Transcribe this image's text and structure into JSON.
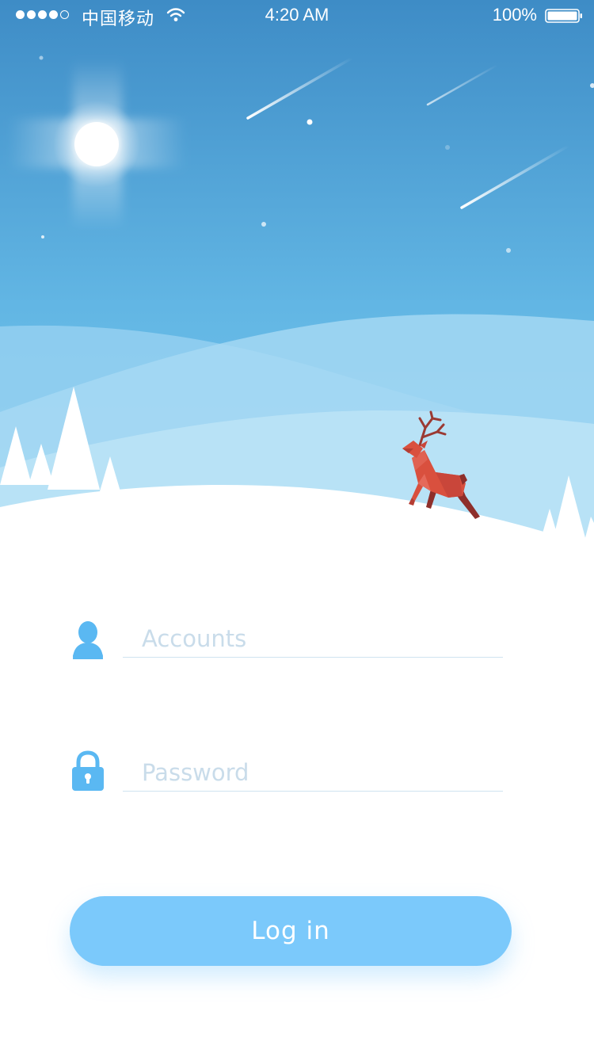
{
  "status_bar": {
    "carrier": "中国移动",
    "time": "4:20 AM",
    "battery": "100%"
  },
  "login_form": {
    "account_placeholder": "Accounts",
    "password_placeholder": "Password",
    "login_label": "Log in"
  },
  "colors": {
    "sky_top": "#4a97cd",
    "sky_bottom": "#6fc4ec",
    "accent": "#7bc9fb",
    "icon": "#5ab8f2",
    "deer": "#d9503e"
  },
  "icons": {
    "account": "user-icon",
    "password": "lock-icon"
  }
}
